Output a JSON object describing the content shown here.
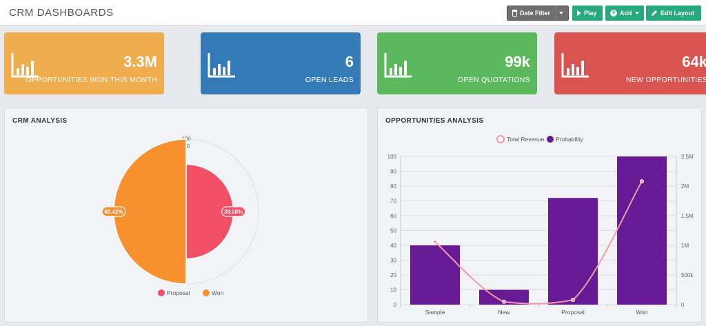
{
  "header": {
    "title": "CRM DASHBOARDS",
    "date_filter_label": "Date Filter",
    "play_label": "Play",
    "add_label": "Add",
    "edit_layout_label": "Edit Layout"
  },
  "stat_cards": [
    {
      "value": "3.3M",
      "label": "OPPORTUNITIES WON THIS MONTH",
      "color": "#f0ad4e",
      "icon": "bar-chart-icon"
    },
    {
      "value": "6",
      "label": "OPEN LEADS",
      "color": "#337ab7",
      "icon": "bar-chart-icon"
    },
    {
      "value": "99k",
      "label": "OPEN QUOTATIONS",
      "color": "#5cb85c",
      "icon": "bar-chart-icon"
    },
    {
      "value": "64k",
      "label": "NEW OPPORTUNITIES",
      "color": "#d9534f",
      "icon": "bar-chart-icon"
    }
  ],
  "crm_analysis": {
    "title": "CRM ANALYSIS",
    "chart_data": {
      "type": "pie",
      "variant": "polar-area",
      "title": "CRM ANALYSIS",
      "radial_ticks": [
        "100",
        "0"
      ],
      "slices": [
        {
          "name": "Proposal",
          "percent_label": "39.58%",
          "percent": 39.58,
          "color": "#f25066"
        },
        {
          "name": "Won",
          "percent_label": "60.42%",
          "percent": 60.42,
          "color": "#f7902f"
        }
      ],
      "legend": [
        "Proposal",
        "Won"
      ],
      "legend_position": "bottom"
    }
  },
  "opportunities_analysis": {
    "title": "OPPORTUNITIES ANALYSIS",
    "chart_data": {
      "type": "bar",
      "title": "OPPORTUNITIES ANALYSIS",
      "categories": [
        "Sample",
        "New",
        "Proposal",
        "Won"
      ],
      "series": [
        {
          "name": "Probability",
          "kind": "bar",
          "axis": "left",
          "values": [
            40,
            10,
            72,
            100
          ],
          "color": "#661a94"
        },
        {
          "name": "Total Revenue",
          "kind": "line",
          "axis": "right",
          "values": [
            1060000,
            50000,
            80000,
            2080000
          ],
          "color": "#f09aa6"
        }
      ],
      "y_left": {
        "min": 0,
        "max": 100,
        "ticks": [
          "0",
          "10",
          "20",
          "30",
          "40",
          "50",
          "60",
          "70",
          "80",
          "90",
          "100"
        ]
      },
      "y_right": {
        "min": 0,
        "max": 2500000,
        "ticks": [
          "0",
          "500k",
          "1M",
          "1.5M",
          "2M",
          "2.5M"
        ]
      },
      "legend": [
        "Total Revenue",
        "Probability"
      ],
      "legend_position": "top",
      "grid": true
    }
  }
}
